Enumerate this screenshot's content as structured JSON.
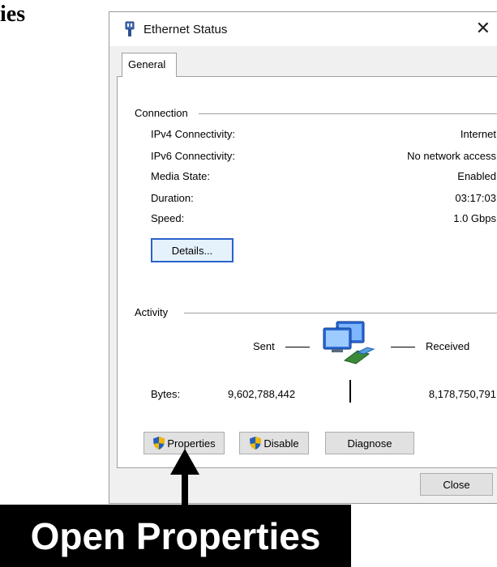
{
  "page_fragment": "ies",
  "window": {
    "title": "Ethernet Status",
    "close_glyph": "✕",
    "icon": "ethernet-plug-icon"
  },
  "tabs": [
    {
      "label": "General",
      "selected": true
    }
  ],
  "connection": {
    "group_label": "Connection",
    "rows": [
      {
        "label": "IPv4 Connectivity:",
        "value": "Internet"
      },
      {
        "label": "IPv6 Connectivity:",
        "value": "No network access"
      },
      {
        "label": "Media State:",
        "value": "Enabled"
      },
      {
        "label": "Duration:",
        "value": "03:17:03"
      },
      {
        "label": "Speed:",
        "value": "1.0 Gbps"
      }
    ],
    "details_button": "Details..."
  },
  "activity": {
    "group_label": "Activity",
    "sent_label": "Sent",
    "received_label": "Received",
    "bytes_label": "Bytes:",
    "bytes_sent": "9,602,788,442",
    "bytes_received": "8,178,750,791",
    "icon": "network-computers-icon"
  },
  "buttons": {
    "properties": "Properties",
    "disable": "Disable",
    "diagnose": "Diagnose",
    "close": "Close"
  },
  "annotation": {
    "callout": "Open Properties"
  },
  "colors": {
    "focus_border": "#2a62c9",
    "dialog_bg": "#f0f0f0",
    "shield_blue": "#1f5fbf",
    "shield_yellow": "#f2b705"
  }
}
